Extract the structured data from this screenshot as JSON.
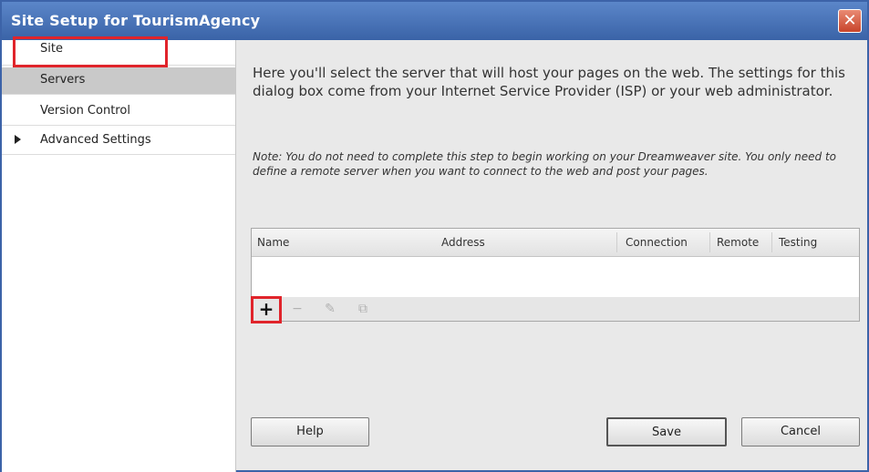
{
  "window": {
    "title": "Site Setup for TourismAgency",
    "close_glyph": "✕"
  },
  "sidebar": {
    "items": [
      {
        "label": "Site"
      },
      {
        "label": "Servers"
      },
      {
        "label": "Version Control"
      },
      {
        "label": "Advanced Settings"
      }
    ]
  },
  "content": {
    "intro": "Here you'll select the server that will host your pages on the web. The settings for this dialog box come from your Internet Service Provider (ISP) or your web administrator.",
    "note": "Note: You do not need to complete this step to begin working on your Dreamweaver site. You only need to define a remote server when you want to connect to the web and post your pages.",
    "table": {
      "headers": [
        "Name",
        "Address",
        "Connection",
        "Remote",
        "Testing"
      ]
    },
    "toolbar": {
      "add_glyph": "+",
      "remove_glyph": "−",
      "edit_glyph": "✎",
      "duplicate_glyph": "⧉"
    }
  },
  "buttons": {
    "help": "Help",
    "save": "Save",
    "cancel": "Cancel"
  },
  "colors": {
    "titlebar": "#3a63a7",
    "selected_row": "#c9c9c9",
    "highlight": "#e0242b"
  },
  "icons": [
    "close-icon",
    "expand-arrow-icon",
    "add-icon",
    "remove-icon",
    "edit-icon",
    "duplicate-icon"
  ]
}
